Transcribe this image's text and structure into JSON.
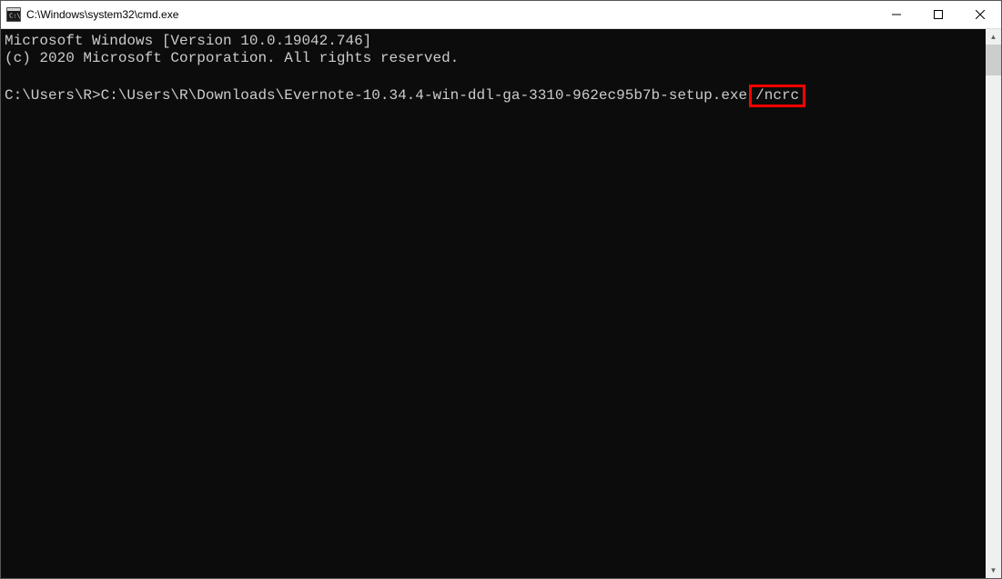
{
  "window": {
    "title": "C:\\Windows\\system32\\cmd.exe"
  },
  "terminal": {
    "line1": "Microsoft Windows [Version 10.0.19042.746]",
    "line2": "(c) 2020 Microsoft Corporation. All rights reserved.",
    "blank": "",
    "prompt_text": "C:\\Users\\R>C:\\Users\\R\\Downloads\\Evernote-10.34.4-win-ddl-ga-3310-962ec95b7b-setup.exe",
    "highlight_text": "/ncrc"
  },
  "icons": {
    "minimize": "minimize",
    "maximize": "maximize",
    "close": "close",
    "scroll_up": "▲",
    "scroll_down": "▼"
  }
}
